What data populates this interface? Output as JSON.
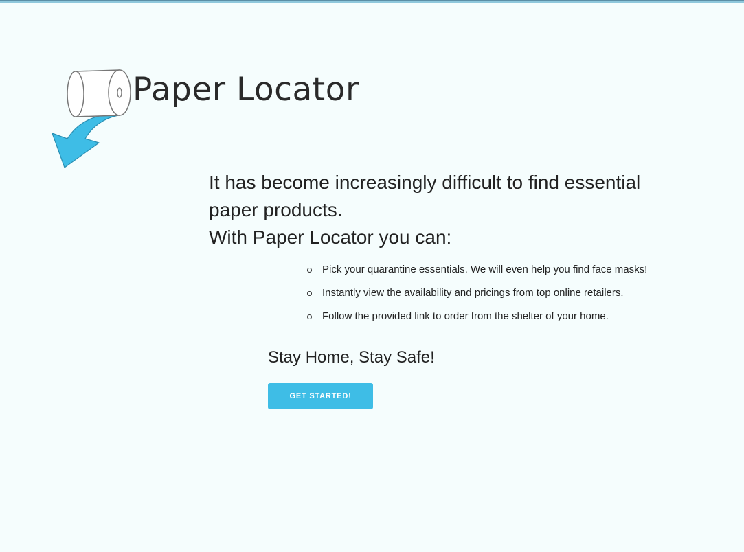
{
  "brand": {
    "title": "Paper Locator",
    "logo_icon": "toilet-paper-arrow-icon",
    "accent_color": "#3ebde6"
  },
  "intro": {
    "line1": "It has become increasingly difficult to find essential paper products.",
    "line2": "With Paper Locator you can:"
  },
  "features": [
    "Pick your quarantine essentials. We will even help you find face masks!",
    "Instantly view the availability and pricings from top online retailers.",
    "Follow the provided link to order from the shelter of your home."
  ],
  "tagline": "Stay Home, Stay Safe!",
  "cta": {
    "label": "GET STARTED!",
    "color": "#3ebde6"
  }
}
